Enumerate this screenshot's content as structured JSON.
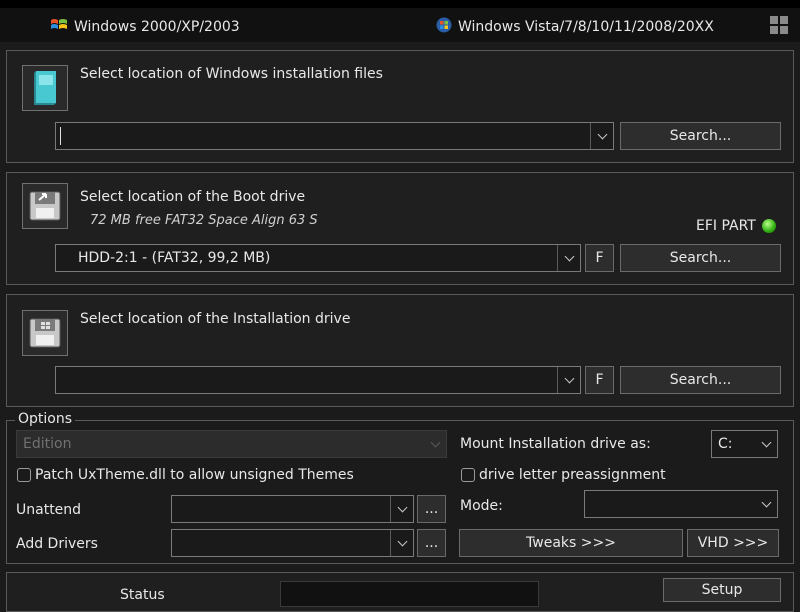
{
  "os_tabs": {
    "legacy_label": "Windows 2000/XP/2003",
    "modern_label": "Windows Vista/7/8/10/11/2008/20XX"
  },
  "install_files": {
    "title": "Select location of Windows installation files",
    "path_value": "",
    "search_label": "Search..."
  },
  "boot_drive": {
    "title": "Select location of the Boot drive",
    "info": "72 MB free FAT32 Space Align  63 S",
    "efi_label": "EFI PART",
    "selected": "HDD-2:1 -   (FAT32, 99,2 MB)",
    "format_label": "F",
    "search_label": "Search..."
  },
  "install_drive": {
    "title": "Select location of the Installation drive",
    "selected": "",
    "format_label": "F",
    "search_label": "Search..."
  },
  "options": {
    "legend": "Options",
    "edition_placeholder": "Edition",
    "patch_uxtheme_label": "Patch UxTheme.dll to allow unsigned Themes",
    "unattend_label": "Unattend",
    "add_drivers_label": "Add Drivers",
    "browse_label": "...",
    "mount_label": "Mount Installation drive as:",
    "mount_value": "C:",
    "preassign_label": "drive letter preassignment",
    "mode_label": "Mode:",
    "mode_value": "",
    "tweaks_label": "Tweaks >>>",
    "vhd_label": "VHD >>>"
  },
  "status": {
    "label": "Status",
    "value": "",
    "setup_label": "Setup"
  },
  "colors": {
    "background": "#1b1b1b",
    "efi_led": "#2fae10"
  }
}
